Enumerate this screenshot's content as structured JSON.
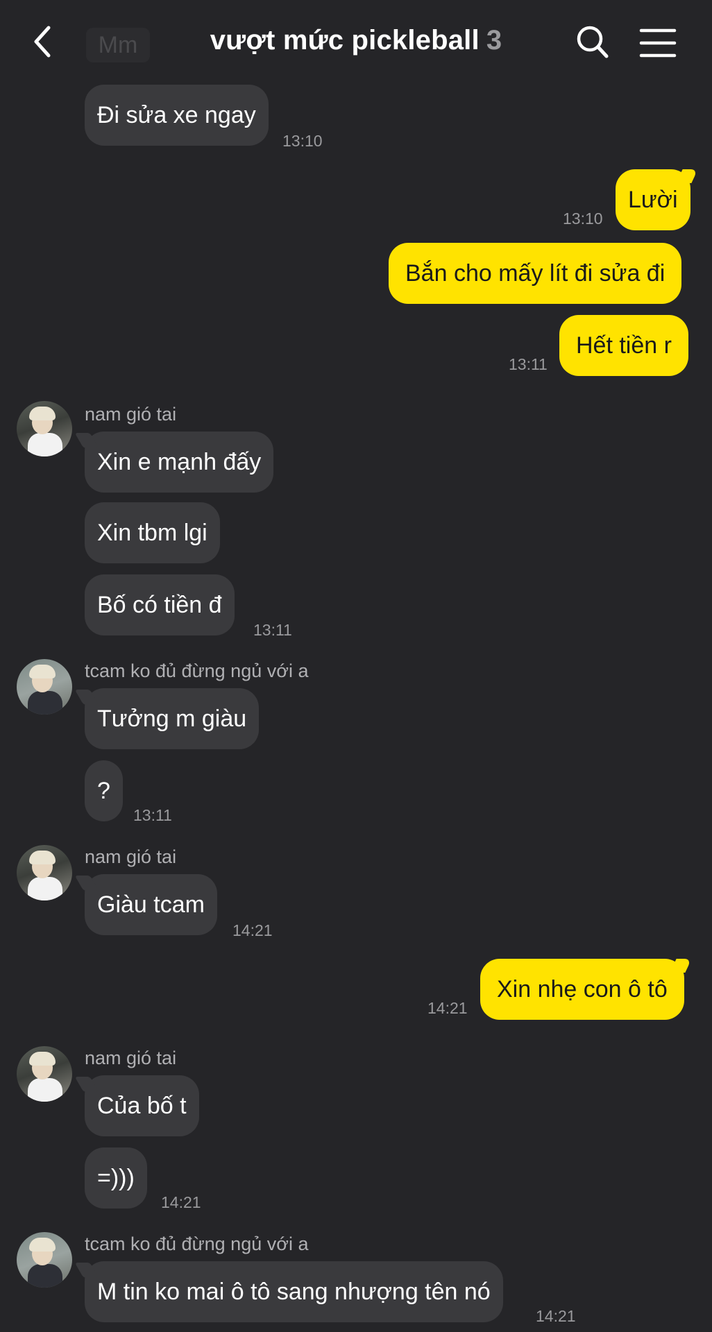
{
  "header": {
    "back_icon": "chevron-left-icon",
    "ghost_text": "Mm",
    "title": "vượt mức pickleball",
    "member_count": "3",
    "search_icon": "search-icon",
    "menu_icon": "hamburger-menu-icon"
  },
  "colors": {
    "background": "#252528",
    "incoming_bubble": "#3a3a3d",
    "outgoing_bubble": "#ffe300"
  },
  "messages": {
    "m1": {
      "text": "Đi sửa xe ngay",
      "time": "13:10"
    },
    "m2": {
      "text": "Lười",
      "time": "13:10"
    },
    "m3": {
      "text": "Bắn cho mấy lít đi sửa đi"
    },
    "m4": {
      "text": "Hết tiền r",
      "time": "13:11"
    },
    "g1": {
      "sender": "nam gió tai"
    },
    "m5": {
      "text": "Xin e mạnh đấy"
    },
    "m6": {
      "text": "Xin tbm lgi"
    },
    "m7": {
      "text": "Bố có tiền đ",
      "time": "13:11"
    },
    "g2": {
      "sender": "tcam ko đủ đừng ngủ với a"
    },
    "m8": {
      "text": "Tưởng m giàu"
    },
    "m9": {
      "text": "?",
      "time": "13:11"
    },
    "g3": {
      "sender": "nam gió tai"
    },
    "m10": {
      "text": "Giàu tcam",
      "time": "14:21"
    },
    "m11": {
      "text": "Xin nhẹ con ô tô",
      "time": "14:21"
    },
    "g4": {
      "sender": "nam gió tai"
    },
    "m12": {
      "text": "Của bố t"
    },
    "m13": {
      "text": "=)))",
      "time": "14:21"
    },
    "g5": {
      "sender": "tcam ko đủ đừng ngủ với a"
    },
    "m14": {
      "text": "M tin ko mai ô tô sang nhượng tên nó",
      "time": "14:21"
    }
  }
}
